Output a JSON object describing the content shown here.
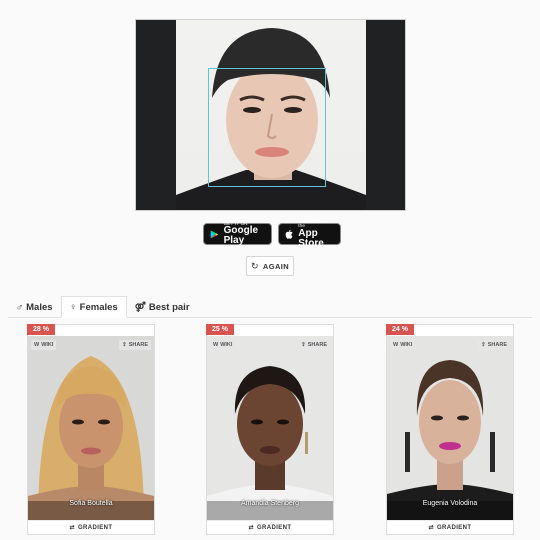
{
  "upload": {
    "alt": "uploaded photo with detected face"
  },
  "stores": {
    "google_small": "GET IT ON",
    "google_big": "Google Play",
    "apple_small": "Download on the",
    "apple_big": "App Store"
  },
  "again_label": "AGAIN",
  "tabs": [
    {
      "icon": "♂",
      "label": "Males"
    },
    {
      "icon": "♀",
      "label": "Females"
    },
    {
      "icon": "⚤",
      "label": "Best pair"
    }
  ],
  "card_labels": {
    "wiki": "WIKI",
    "share": "SHARE",
    "gradient": "GRADIENT"
  },
  "results": [
    {
      "percent": "28 %",
      "name": "Sofia Boutella"
    },
    {
      "percent": "25 %",
      "name": "Amandla Stenberg"
    },
    {
      "percent": "24 %",
      "name": "Eugenia Volodina"
    }
  ],
  "colors": {
    "accent": "#d9534f",
    "face_box": "#5fc4d6"
  }
}
